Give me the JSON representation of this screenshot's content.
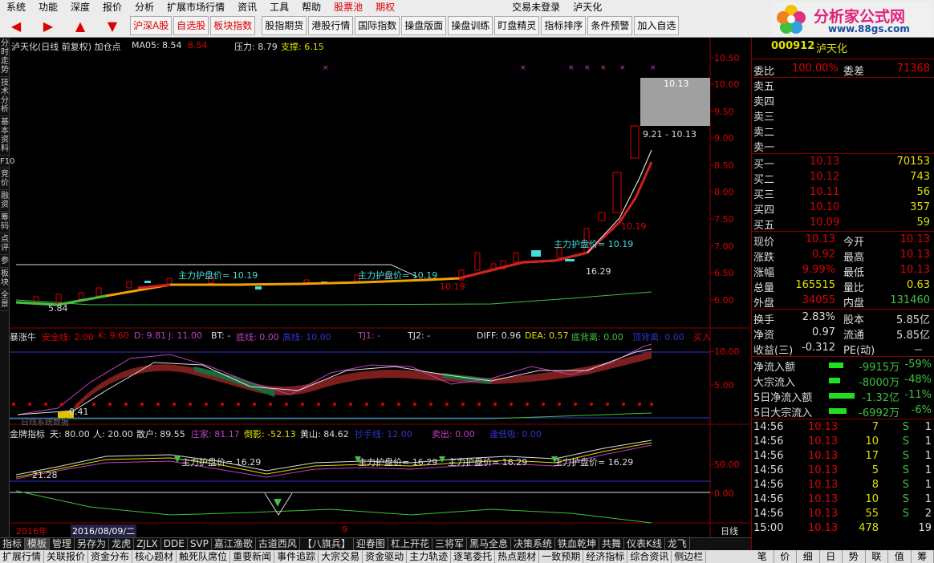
{
  "menubar": {
    "items": [
      "系统",
      "功能",
      "深度",
      "报价",
      "分析",
      "扩展市场行情",
      "资讯",
      "工具",
      "帮助"
    ],
    "stockpool": "股票池",
    "period": "期权",
    "login": "交易未登录",
    "stock_name": "泸天化"
  },
  "toolbar": {
    "buttons": [
      "沪深A股",
      "自选股",
      "板块指数",
      "股指期货",
      "港股行情",
      "国际指数",
      "操盘版面",
      "操盘训练",
      "盯盘精灵",
      "指标排序",
      "条件预警",
      "加入自选"
    ]
  },
  "logo": {
    "title": "分析家公式网",
    "url": "www.88gs.com"
  },
  "leftstrip": [
    "分时走势",
    "技术分析",
    "基本资料",
    "F10",
    "竞价",
    "融资",
    "筹码",
    "点评",
    "参",
    "板块",
    "全景"
  ],
  "main": {
    "title": "泸天化(日线 前复权) 加仓点",
    "ma_label": "MA05:",
    "ma_val1": "8.54",
    "ma_val2": "8.54",
    "pressure": "压力: 8.79",
    "support": "支撑: 6.15",
    "yaxis": [
      "10.50",
      "10.00",
      "9.50",
      "9.00",
      "8.50",
      "8.00",
      "7.50",
      "7.00",
      "6.50",
      "6.00"
    ],
    "ann_box": "10.13",
    "ann_range": "9.21 - 10.13",
    "ann_1019a": "10.19",
    "ann_1019b": "10.19",
    "ann_1629": "16.29",
    "ann_584": "5.84",
    "hp1": "主力护盘价= 10.19",
    "hp2": "主力护盘价= 10.19",
    "hp3": "主力护盘价= 10.19"
  },
  "ind1": {
    "name": "暴涨牛",
    "s1": "安全线: 2.00",
    "s2": "K: 9.60",
    "s3": "D: 9.81",
    "s4": "J: 11.00",
    "s5": "BT: -",
    "s6": "底线: 0.00",
    "s7": "高线: 10.00",
    "s8": "TJ1: -",
    "s9": "TJ2: -",
    "s10": "DIFF: 0.96",
    "s11": "DEA: 0.57",
    "s12": "底背离: 0.00",
    "s13": "顶背离: 0.00",
    "s14": "买入",
    "yaxis": [
      "10.00",
      "5.00"
    ],
    "ann": "0.41",
    "sub": "日线系统数据"
  },
  "ind2": {
    "name": "金牌指标",
    "s1": "天: 80.00",
    "s2": "人: 20.00",
    "s3": "散户: 89.55",
    "s4": "庄家: 81.17",
    "s5": "倒影: -52.13",
    "s6": "黄山: 84.62",
    "s7": "抄手线: 12.00",
    "s8": "卖出: 0.00",
    "s9": "逢低吸: 0.00",
    "yaxis": [
      "50.00",
      "0.00"
    ],
    "ann": "21.28",
    "hp1": "主力护盘价= 16.29",
    "hp2": "主力护盘价= 16.29",
    "hp3": "主力护盘价= 16.29",
    "hp4": "主力护盘价= 16.29"
  },
  "timeaxis": {
    "year": "2016年",
    "date": "2016/08/09/二",
    "mark": "9",
    "period": "日线"
  },
  "quote": {
    "code": "000912",
    "name": "泸天化",
    "wb_label": "委比",
    "wb": "100.00%",
    "wc_label": "委差",
    "wc": "71368",
    "sells": [
      {
        "label": "卖五",
        "price": "",
        "vol": ""
      },
      {
        "label": "卖四",
        "price": "",
        "vol": ""
      },
      {
        "label": "卖三",
        "price": "",
        "vol": ""
      },
      {
        "label": "卖二",
        "price": "",
        "vol": ""
      },
      {
        "label": "卖一",
        "price": "",
        "vol": ""
      }
    ],
    "buys": [
      {
        "label": "买一",
        "price": "10.13",
        "vol": "70153"
      },
      {
        "label": "买二",
        "price": "10.12",
        "vol": "743"
      },
      {
        "label": "买三",
        "price": "10.11",
        "vol": "56"
      },
      {
        "label": "买四",
        "price": "10.10",
        "vol": "357"
      },
      {
        "label": "买五",
        "price": "10.09",
        "vol": "59"
      }
    ],
    "stats": [
      {
        "l1": "现价",
        "v1": "10.13",
        "l2": "今开",
        "v2": "10.13"
      },
      {
        "l1": "涨跌",
        "v1": "0.92",
        "l2": "最高",
        "v2": "10.13"
      },
      {
        "l1": "涨幅",
        "v1": "9.99%",
        "l2": "最低",
        "v2": "10.13"
      },
      {
        "l1": "总量",
        "v1": "165515",
        "l2": "量比",
        "v2": "0.63"
      },
      {
        "l1": "外盘",
        "v1": "34055",
        "l2": "内盘",
        "v2": "131460"
      }
    ],
    "stats2": [
      {
        "l1": "换手",
        "v1": "2.83%",
        "l2": "股本",
        "v2": "5.85亿"
      },
      {
        "l1": "净资",
        "v1": "0.97",
        "l2": "流通",
        "v2": "5.85亿"
      },
      {
        "l1": "收益(三)",
        "v1": "-0.312",
        "l2": "PE(动)",
        "v2": "－"
      }
    ],
    "flows": [
      {
        "label": "净流入额",
        "val": "-9915万",
        "pct": "-59%",
        "bar": 0.55
      },
      {
        "label": "大宗流入",
        "val": "-8000万",
        "pct": "-48%",
        "bar": 0.45
      },
      {
        "label": "5日净流入额",
        "val": "-1.32亿",
        "pct": "-11%",
        "bar": 1.0
      },
      {
        "label": "5日大宗流入",
        "val": "-6992万",
        "pct": "-6%",
        "bar": 0.7
      }
    ],
    "ticks": [
      {
        "t": "14:56",
        "p": "10.13",
        "v": "7",
        "s": "S",
        "n": "1"
      },
      {
        "t": "14:56",
        "p": "10.13",
        "v": "10",
        "s": "S",
        "n": "1"
      },
      {
        "t": "14:56",
        "p": "10.13",
        "v": "17",
        "s": "S",
        "n": "1"
      },
      {
        "t": "14:56",
        "p": "10.13",
        "v": "5",
        "s": "S",
        "n": "1"
      },
      {
        "t": "14:56",
        "p": "10.13",
        "v": "8",
        "s": "S",
        "n": "1"
      },
      {
        "t": "14:56",
        "p": "10.13",
        "v": "10",
        "s": "S",
        "n": "1"
      },
      {
        "t": "14:56",
        "p": "10.13",
        "v": "55",
        "s": "S",
        "n": "2"
      },
      {
        "t": "15:00",
        "p": "10.13",
        "v": "478",
        "s": "",
        "n": "19"
      }
    ]
  },
  "bottom1": [
    "指标",
    "模板",
    "管理",
    "另存为",
    "龙虎",
    "ZJLX",
    "DDE",
    "SVP",
    "嘉江渔歌",
    "古道西风",
    "【八旗兵】",
    "迎春图",
    "杠上开花",
    "三将军",
    "黑马全息",
    "决策系统",
    "铁血乾坤",
    "共舞",
    "仪表K线",
    "龙飞"
  ],
  "bottom2": [
    "扩展行情",
    "关联报价",
    "资金分布",
    "核心题材",
    "触死队席位",
    "重要新闻",
    "事件追踪",
    "大宗交易",
    "资金驱动",
    "主力轨迹",
    "逐笔委托",
    "热点题材",
    "一致预期",
    "经济指标",
    "综合资讯",
    "侧边栏"
  ],
  "rtabs": [
    "笔",
    "价",
    "细",
    "日",
    "势",
    "联",
    "值",
    "筹"
  ]
}
